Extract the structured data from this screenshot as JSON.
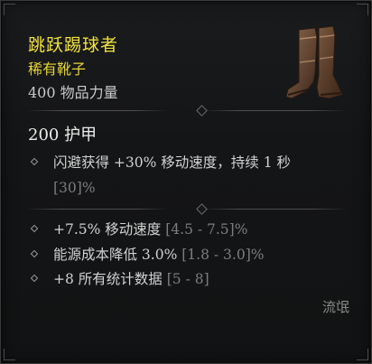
{
  "item": {
    "name": "跳跃踢球者",
    "type": "稀有靴子",
    "power": "400 物品力量",
    "icon": "boots-icon"
  },
  "stats": {
    "armor": "200 护甲",
    "implicit": {
      "text": "闪避获得 +30% 移动速度，持续 1 秒",
      "range": "[30]%"
    }
  },
  "affixes": [
    {
      "text": "+7.5% 移动速度",
      "range": "[4.5 - 7.5]%"
    },
    {
      "text": "能源成本降低 3.0%",
      "range": "[1.8 - 3.0]%"
    },
    {
      "text": "+8 所有统计数据",
      "range": "[5 - 8]"
    }
  ],
  "footer": {
    "class_tag": "流氓"
  },
  "colors": {
    "rare_name": "#f2e23c",
    "range_gray": "#7d7d7d"
  }
}
